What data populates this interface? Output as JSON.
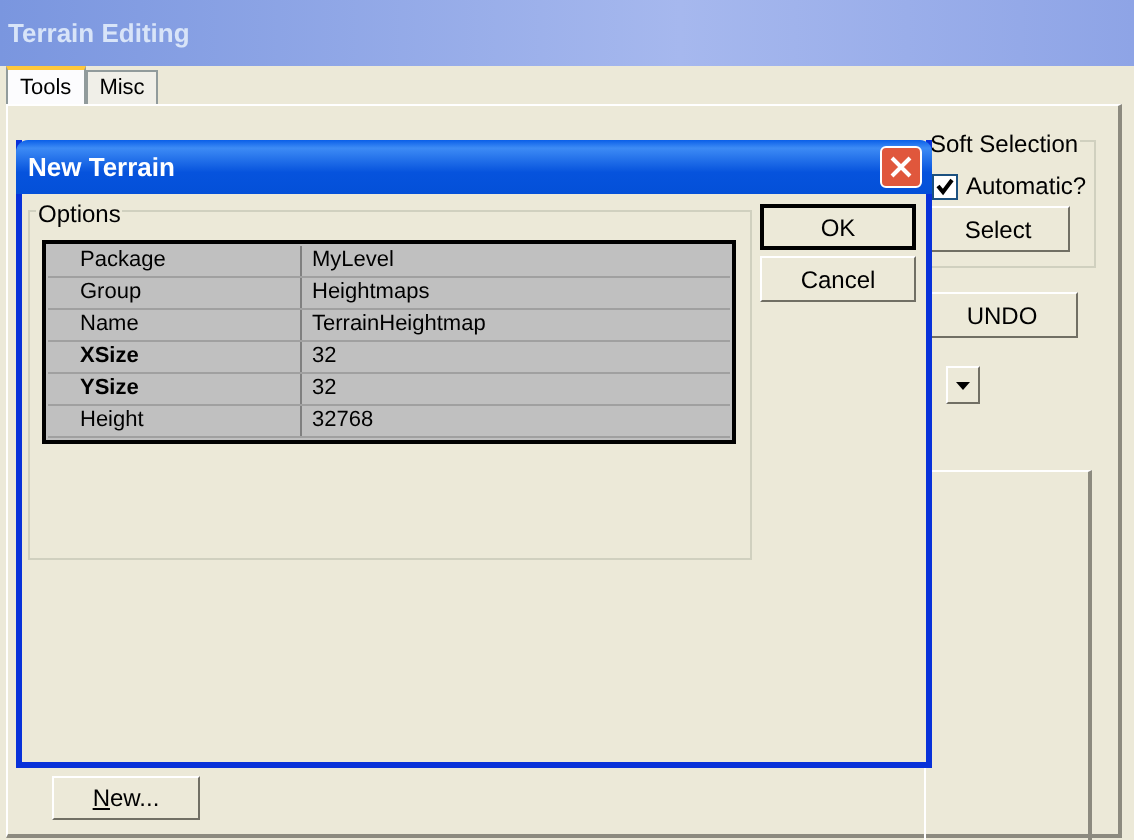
{
  "window": {
    "title": "Terrain Editing",
    "active": false
  },
  "tabs": [
    {
      "label": "Tools",
      "selected": true
    },
    {
      "label": "Misc",
      "selected": false
    }
  ],
  "soft_selection": {
    "title": "Soft Selection",
    "automatic": {
      "label": "Automatic?",
      "checked": true
    },
    "select_button": "Select"
  },
  "undo_button": "UNDO",
  "new_button": "New...",
  "dialog": {
    "title": "New Terrain",
    "active": true,
    "group": "Options",
    "properties": [
      {
        "name": "Package",
        "value": "MyLevel",
        "bold": false
      },
      {
        "name": "Group",
        "value": "Heightmaps",
        "bold": false
      },
      {
        "name": "Name",
        "value": "TerrainHeightmap",
        "bold": false
      },
      {
        "name": "XSize",
        "value": "32",
        "bold": true
      },
      {
        "name": "YSize",
        "value": "32",
        "bold": true
      },
      {
        "name": "Height",
        "value": "32768",
        "bold": false
      }
    ],
    "buttons": [
      {
        "label": "OK",
        "default": true
      },
      {
        "label": "Cancel",
        "default": false
      }
    ]
  }
}
